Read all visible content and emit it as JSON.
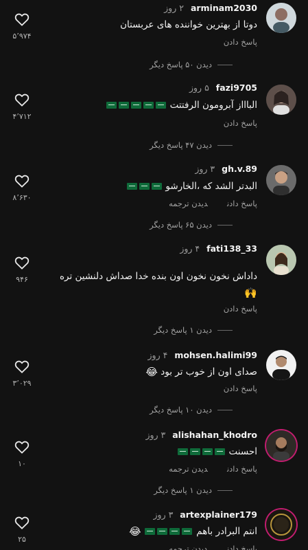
{
  "comments": [
    {
      "username": "arminam2030",
      "time": "۲ روز",
      "text": "دوتا از بهترین خواننده های عربستان",
      "flags": 0,
      "reply": "پاسخ دادن",
      "translate": "",
      "view_replies": "دیدن ۵۰ پاسخ دیگر",
      "likes": "۵٬۹۷۴"
    },
    {
      "username": "fazi9705",
      "time": "۵ روز",
      "text": "الباااز آبرومون الرفتتت",
      "flags": 5,
      "reply": "پاسخ دادن",
      "translate": "",
      "view_replies": "دیدن ۴۷ پاسخ دیگر",
      "likes": "۴٬۷۱۲"
    },
    {
      "username": "gh.v.89",
      "time": "۳ روز",
      "text": "البدتر الشد که ،الخارشو",
      "flags": 3,
      "reply": "پاسخ دادن",
      "translate": "دیدن ترجمه",
      "view_replies": "دیدن ۶۵ پاسخ دیگر",
      "likes": "۸٬۶۳۰"
    },
    {
      "username": "fati138_33",
      "time": "۴ روز",
      "text": "داداش نخون نخون اون بنده خدا صداش دلنشین تره",
      "extra": "🙌",
      "flags": 0,
      "reply": "پاسخ دادن",
      "translate": "",
      "view_replies": "دیدن ۱ پاسخ دیگر",
      "likes": "۹۴۶"
    },
    {
      "username": "mohsen.halimi99",
      "time": "۴ روز",
      "text": "صدای اون از خوب تر بود",
      "extra": "😂",
      "flags": 0,
      "reply": "پاسخ دادن",
      "translate": "",
      "view_replies": "دیدن ۱۰ پاسخ دیگر",
      "likes": "۳٬۰۲۹"
    },
    {
      "username": "alishahan_khodro",
      "time": "۳ روز",
      "text": "احسنت",
      "flags": 4,
      "reply": "پاسخ دادن",
      "translate": "دیدن ترجمه",
      "view_replies": "دیدن ۱ پاسخ دیگر",
      "likes": "۱۰"
    },
    {
      "username": "artexplainer179",
      "time": "۳ روز",
      "text": "انتم البرادر باهم",
      "extra": "😂",
      "flags": 4,
      "reply": "پاسخ دادن",
      "translate": "دیدن ترجمه",
      "view_replies": "",
      "likes": "۲۵"
    }
  ],
  "icons": {
    "like": "heart-outline-icon",
    "flag": "saudi-flag-emoji"
  },
  "colors": {
    "background": "#121212",
    "text": "#f2f2f2",
    "muted": "#a3a3a3",
    "story_ring": "#c21c6f"
  }
}
